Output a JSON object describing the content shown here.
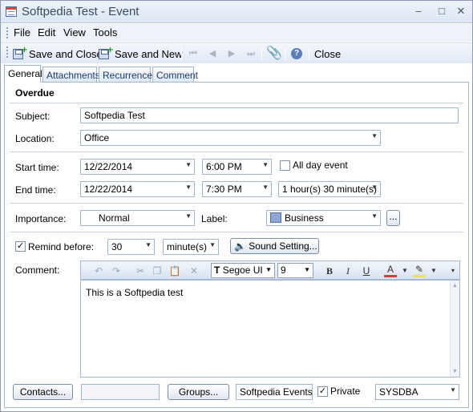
{
  "window": {
    "title": "Softpedia Test - Event",
    "min": "–",
    "max": "□",
    "close": "✕"
  },
  "menu": [
    {
      "label": "File"
    },
    {
      "label": "Edit"
    },
    {
      "label": "View"
    },
    {
      "label": "Tools"
    }
  ],
  "toolbar": {
    "save_close": "Save and Close",
    "save_new": "Save and New",
    "close": "Close"
  },
  "tabs": [
    {
      "label": "General",
      "active": true
    },
    {
      "label": "Attachments"
    },
    {
      "label": "Recurrence"
    },
    {
      "label": "Comment"
    }
  ],
  "form": {
    "status": "Overdue",
    "subject_label": "Subject:",
    "subject_value": "Softpedia Test",
    "location_label": "Location:",
    "location_value": "Office",
    "start_label": "Start time:",
    "start_date": "12/22/2014",
    "start_time": "6:00 PM",
    "all_day_label": "All day event",
    "end_label": "End time:",
    "end_date": "12/22/2014",
    "end_time": "7:30 PM",
    "duration": "1 hour(s) 30 minute(s)",
    "importance_label": "Importance:",
    "importance_value": "Normal",
    "label_label": "Label:",
    "label_value": "Business",
    "label_color": "#8fa7d8",
    "label_more": "...",
    "remind_label": "Remind before:",
    "remind_value": "30",
    "remind_unit": "minute(s)",
    "sound_button": "Sound Setting...",
    "comment_label": "Comment:",
    "font_name": "Segoe UI",
    "font_size": "9",
    "comment_text": "This is a Softpedia test"
  },
  "footer": {
    "contacts_button": "Contacts...",
    "contacts_value": "",
    "groups_button": "Groups...",
    "groups_value": "Softpedia Events",
    "private_label": "Private",
    "user_value": "SYSDBA"
  }
}
